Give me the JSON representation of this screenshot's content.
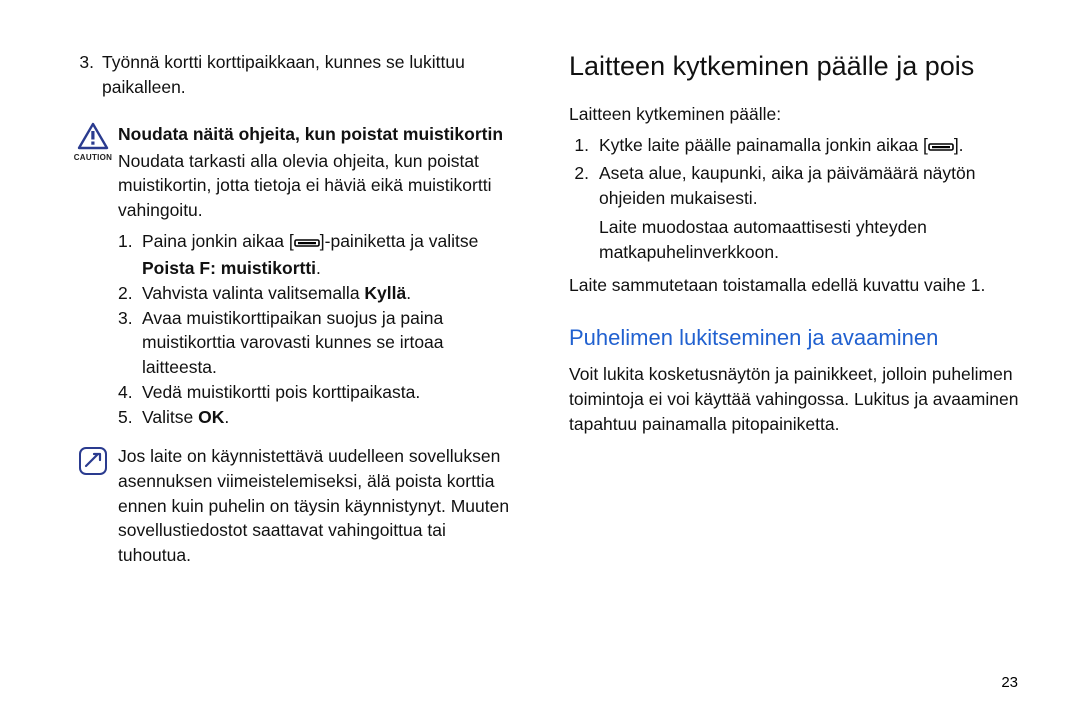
{
  "left": {
    "topItem": {
      "num": "3.",
      "text": "Työnnä kortti korttipaikkaan, kunnes se lukittuu paikalleen."
    },
    "caution": {
      "iconLabel": "CAUTION",
      "title": "Noudata näitä ohjeita, kun poistat muistikortin",
      "intro": "Noudata tarkasti alla olevia ohjeita, kun poistat muistikortin, jotta tietoja ei häviä eikä muistikortti vahingoitu.",
      "items": [
        {
          "n": "1.",
          "pre": "Paina jonkin aikaa [",
          "mid": "]-painiketta ja valitse ",
          "bold": "Poista F: muistikortti",
          "post": "."
        },
        {
          "n": "2.",
          "pre": "Vahvista valinta valitsemalla ",
          "bold": "Kyllä",
          "post": "."
        },
        {
          "n": "3.",
          "text": "Avaa muistikorttipaikan suojus ja paina muistikorttia varovasti kunnes se irtoaa laitteesta."
        },
        {
          "n": "4.",
          "text": "Vedä muistikortti pois korttipaikasta."
        },
        {
          "n": "5.",
          "pre": "Valitse ",
          "bold": "OK",
          "post": "."
        }
      ]
    },
    "note": "Jos laite on käynnistettävä uudelleen sovelluksen asennuksen viimeistelemiseksi, älä poista korttia ennen kuin puhelin on täysin käynnistynyt. Muuten sovellustiedostot saattavat vahingoittua tai tuhoutua."
  },
  "right": {
    "heading": "Laitteen kytkeminen päälle ja pois",
    "intro": "Laitteen kytkeminen päälle:",
    "items": [
      {
        "n": "1.",
        "pre": "Kytke laite päälle painamalla jonkin aikaa [",
        "post": "]."
      },
      {
        "n": "2.",
        "text": "Aseta alue, kaupunki, aika ja päivämäärä näytön ohjeiden mukaisesti."
      }
    ],
    "sub": "Laite muodostaa automaattisesti yhteyden matkapuhelinverkkoon.",
    "after": "Laite sammutetaan toistamalla edellä kuvattu vaihe 1.",
    "h2": "Puhelimen lukitseminen ja avaaminen",
    "p2": "Voit lukita kosketusnäytön ja painikkeet, jolloin puhelimen toimintoja ei voi käyttää vahingossa. Lukitus ja avaaminen tapahtuu painamalla pitopainiketta."
  },
  "pageNumber": "23"
}
